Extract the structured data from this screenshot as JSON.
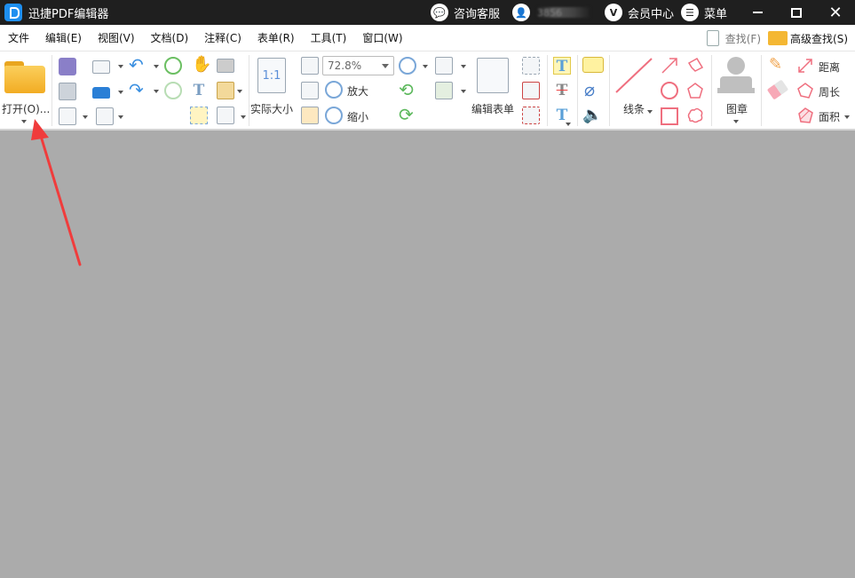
{
  "app": {
    "title": "迅捷PDF编辑器"
  },
  "titlebar": {
    "support_label": "咨询客服",
    "user_id_suffix": "3856",
    "vip_badge": "V",
    "member_center_label": "会员中心",
    "menu_label": "菜单"
  },
  "menubar": {
    "items": [
      "文件",
      "编辑(E)",
      "视图(V)",
      "文档(D)",
      "注释(C)",
      "表单(R)",
      "工具(T)",
      "窗口(W)"
    ],
    "find_label": "查找(F)",
    "advanced_find_label": "高级查找(S)"
  },
  "toolbar": {
    "open_label": "打开(O)...",
    "actual_size_icon_text": "1:1",
    "actual_size_label": "实际大小",
    "zoom_value": "72.8%",
    "zoom_in_label": "放大",
    "zoom_out_label": "缩小",
    "edit_form_label": "编辑表单",
    "lines_label": "线条",
    "stamp_label": "图章",
    "distance_label": "距离",
    "perimeter_label": "周长",
    "area_label": "面积",
    "text_glyph": "T"
  },
  "colors": {
    "titlebar_bg": "#1f1f1f",
    "canvas_bg": "#ababab",
    "annotation_arrow": "#f03c3c",
    "accent_blue": "#1e8ff0"
  }
}
